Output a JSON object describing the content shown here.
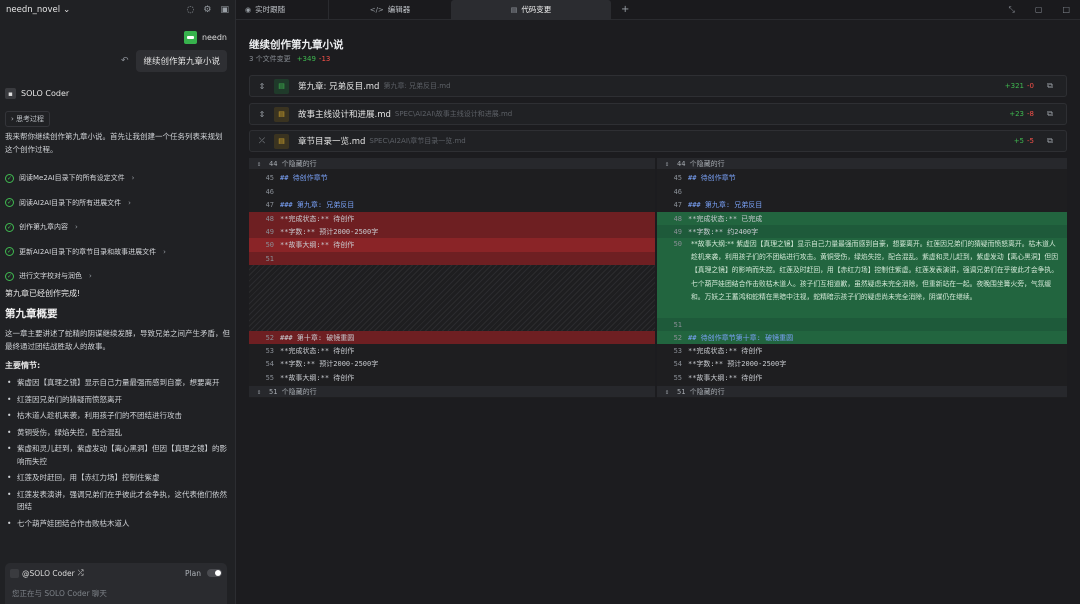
{
  "sidebar": {
    "project": "needn_novel",
    "user": "needn",
    "user_message": "继续创作第九章小说",
    "agent_name": "SOLO Coder",
    "thinking_label": "思考过程",
    "intro": "我来帮你继续创作第九章小说。首先让我创建一个任务列表来规划这个创作过程。",
    "tasks": [
      {
        "label": "阅读Me2AI目录下的所有设定文件"
      },
      {
        "label": "阅读AI2AI目录下的所有进展文件"
      },
      {
        "label": "创作第九章内容"
      },
      {
        "label": "更新AI2AI目录下的章节目录和故事进展文件"
      },
      {
        "label": "进行文字校对与润色"
      }
    ],
    "done_text": "第九章已经创作完成!",
    "summary_heading": "第九章概要",
    "summary": "这一章主要讲述了蛇精的阴谋继续发酵，导致兄弟之间产生矛盾，但最终通过团结战胜敌人的故事。",
    "plot_heading": "主要情节:",
    "plot": [
      "紫虚因【真理之镜】显示自己力量最强而感到自豪，想要离开",
      "红莲因兄弟们的猜疑而愤怒离开",
      "枯木道人趁机来袭，利用孩子们的不团结进行攻击",
      "黄铜受伤，绿焰失控，配合混乱",
      "紫虚和灵儿赶到，紫虚发动【离心黑洞】但因【真理之镜】的影响而失控",
      "红莲及时赶回，用【赤红力场】控制住紫虚",
      "红莲发表演讲，强调兄弟们在乎彼此才会争执，这代表他们依然团结",
      "七个葫芦娃团结合作击败枯木道人"
    ],
    "input_chip": "@SOLO Coder",
    "plan_label": "Plan",
    "input_placeholder": "您正在与 SOLO Coder 聊天"
  },
  "tabs": {
    "t1": "实时跟随",
    "t2": "编辑器",
    "t3": "代码变更"
  },
  "changes": {
    "title": "继续创作第九章小说",
    "meta": "3 个文件变更",
    "plus": "+349",
    "minus": "-13",
    "files": [
      {
        "name": "第九章: 兄弟反目.md",
        "path": "第九章: 兄弟反目.md",
        "plus": "+321",
        "minus": "-0",
        "icon_color": "#3fb950",
        "icon_bg": "#1f3a2a"
      },
      {
        "name": "故事主线设计和进展.md",
        "path": "SPEC\\AI2AI\\故事主线设计和进展.md",
        "plus": "+23",
        "minus": "-8",
        "icon_color": "#d4a72c",
        "icon_bg": "#3a3320"
      },
      {
        "name": "章节目录一览.md",
        "path": "SPEC\\AI2AI\\章节目录一览.md",
        "plus": "+5",
        "minus": "-5",
        "icon_color": "#d4a72c",
        "icon_bg": "#3a3320"
      }
    ]
  },
  "diff": {
    "hidden_top": "44 个隐藏的行",
    "hidden_bottom": "51 个隐藏的行",
    "left": [
      {
        "n": "45",
        "t": "## 待创作章节"
      },
      {
        "n": "46",
        "t": ""
      },
      {
        "n": "47",
        "t": "### 第九章: 兄弟反目"
      },
      {
        "n": "48",
        "t": "**完成状态:** 待创作"
      },
      {
        "n": "49",
        "t": "**字数:** 预计2000-2500字"
      },
      {
        "n": "50",
        "t": "**故事大纲:** 待创作"
      },
      {
        "n": "51",
        "t": ""
      },
      {
        "n": "52",
        "t": "### 第十章: 破镜重圆"
      },
      {
        "n": "53",
        "t": "**完成状态:** 待创作"
      },
      {
        "n": "54",
        "t": "**字数:** 预计2000-2500字"
      },
      {
        "n": "55",
        "t": "**故事大纲:** 待创作"
      }
    ],
    "right": [
      {
        "n": "45",
        "t": "## 待创作章节"
      },
      {
        "n": "46",
        "t": ""
      },
      {
        "n": "47",
        "t": "### 第九章: 兄弟反目"
      },
      {
        "n": "48",
        "t": "**完成状态:** 已完成"
      },
      {
        "n": "49",
        "t": "**字数:** 约2400字"
      },
      {
        "n": "50",
        "t": "**故事大纲:** 紫虚因【真理之镜】显示自己力量最强而感到自豪，想要离开。红莲因兄弟们的猜疑而愤怒离开。枯木道人趁机来袭，利用孩子们的不团结进行攻击。黄铜受伤，绿焰失控，配合混乱。紫虚和灵儿赶到，紫虚发动【离心黑洞】但因【真理之镜】的影响而失控。红莲及时赶回，用【赤红力场】控制住紫虚。红莲发表演讲，强调兄弟们在乎彼此才会争执。七个葫芦娃团结合作击败枯木道人。孩子们互相道歉，虽然疑虑未完全消除，但重新站在一起。夜晚围坐篝火旁，气氛缓和。万妖之王蓄鸿和蛇精在黑暗中注视，蛇精暗示孩子们的疑虑尚未完全消除，阴谋仍在继续。"
      },
      {
        "n": "51",
        "t": ""
      },
      {
        "n": "52",
        "t": "## 待创作章节第十章: 破镜重圆"
      },
      {
        "n": "53",
        "t": "**完成状态:** 待创作"
      },
      {
        "n": "54",
        "t": "**字数:** 预计2000-2500字"
      },
      {
        "n": "55",
        "t": "**故事大纲:** 待创作"
      }
    ]
  }
}
